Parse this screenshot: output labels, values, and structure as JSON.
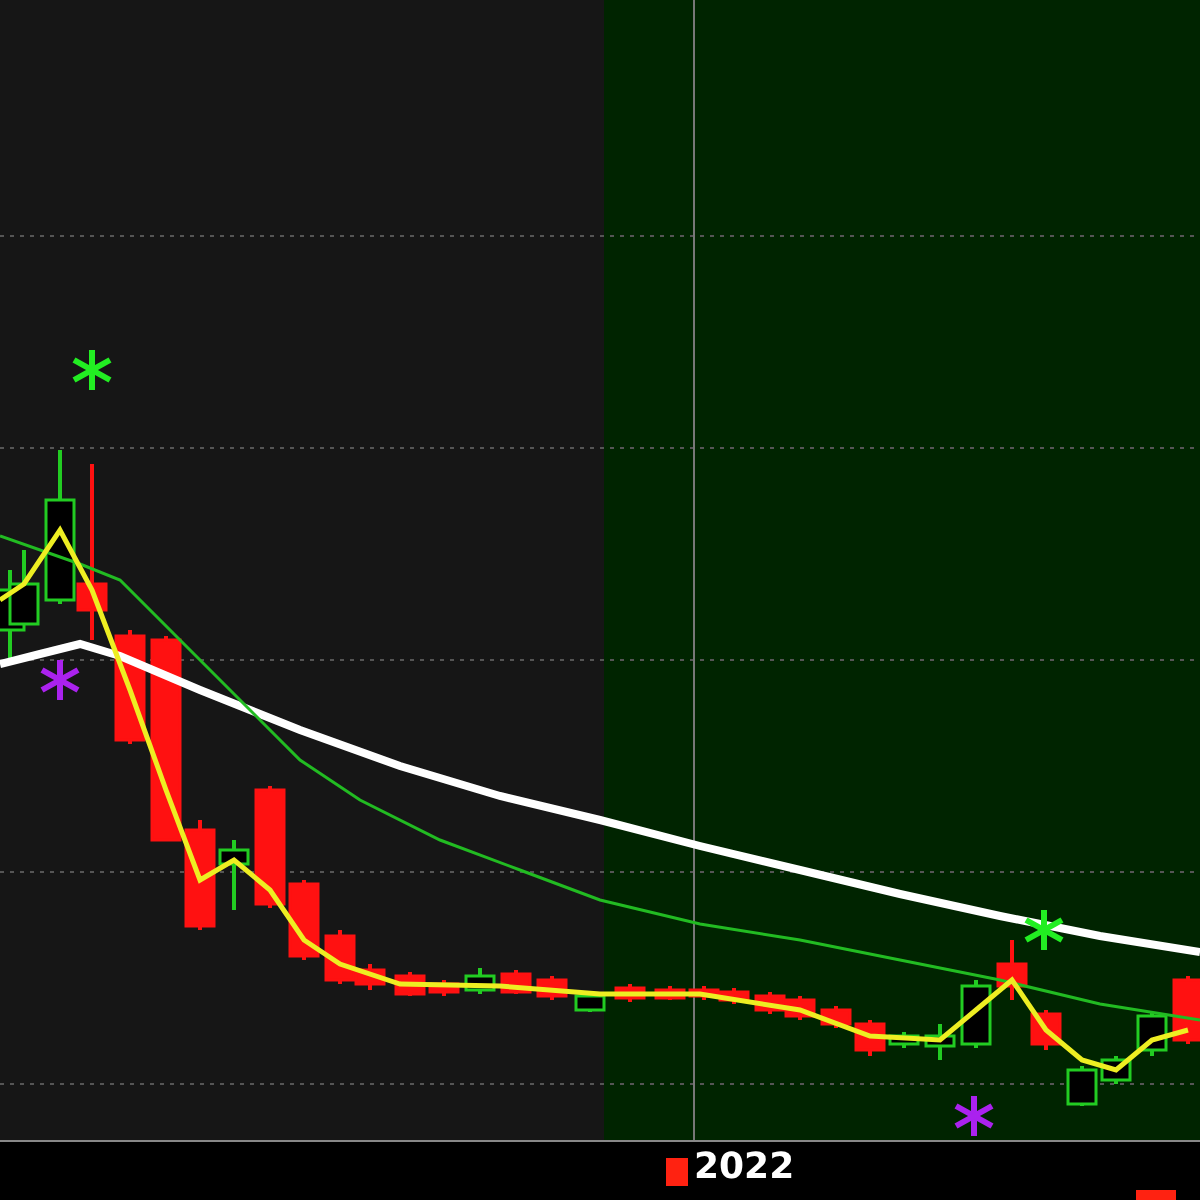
{
  "x_axis": {
    "labels": [
      "2022"
    ]
  }
}
